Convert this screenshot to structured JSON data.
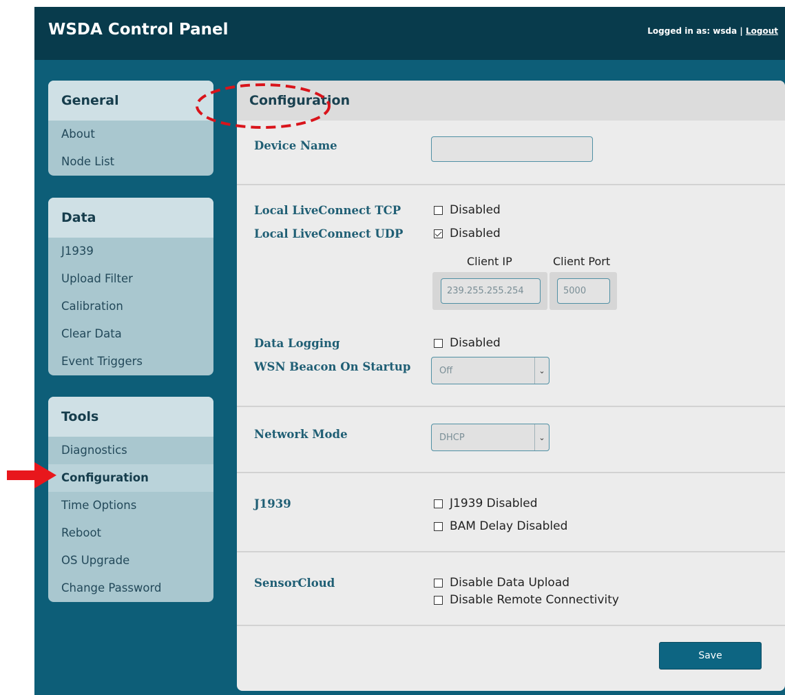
{
  "header": {
    "app_title": "WSDA Control Panel",
    "logged_in_text": "Logged in as: wsda |",
    "logout_label": "Logout"
  },
  "sidebar": {
    "general": {
      "title": "General",
      "items": [
        {
          "label": "About"
        },
        {
          "label": "Node List"
        }
      ]
    },
    "data": {
      "title": "Data",
      "items": [
        {
          "label": "J1939"
        },
        {
          "label": "Upload Filter"
        },
        {
          "label": "Calibration"
        },
        {
          "label": "Clear Data"
        },
        {
          "label": "Event Triggers"
        }
      ]
    },
    "tools": {
      "title": "Tools",
      "items": [
        {
          "label": "Diagnostics"
        },
        {
          "label": "Configuration",
          "active": true
        },
        {
          "label": "Time Options"
        },
        {
          "label": "Reboot"
        },
        {
          "label": "OS Upgrade"
        },
        {
          "label": "Change Password"
        }
      ]
    }
  },
  "config": {
    "title": "Configuration",
    "device_name": {
      "label": "Device Name",
      "value": ""
    },
    "local_tcp": {
      "label": "Local LiveConnect TCP",
      "option": "Disabled",
      "checked": false
    },
    "local_udp": {
      "label": "Local LiveConnect UDP",
      "option": "Disabled",
      "checked": true
    },
    "client_ip": {
      "label": "Client IP",
      "value": "239.255.255.254"
    },
    "client_port": {
      "label": "Client Port",
      "value": "5000"
    },
    "data_logging": {
      "label": "Data Logging",
      "option": "Disabled",
      "checked": false
    },
    "wsn_beacon": {
      "label": "WSN Beacon On Startup",
      "value": "Off"
    },
    "network_mode": {
      "label": "Network Mode",
      "value": "DHCP"
    },
    "j1939": {
      "label": "J1939",
      "options": [
        {
          "label": "J1939 Disabled",
          "checked": false
        },
        {
          "label": "BAM Delay Disabled",
          "checked": false
        }
      ]
    },
    "sensorcloud": {
      "label": "SensorCloud",
      "options": [
        {
          "label": "Disable Data Upload",
          "checked": false
        },
        {
          "label": "Disable Remote Connectivity",
          "checked": false
        }
      ]
    },
    "save_label": "Save"
  },
  "annotations": {
    "highlight_color": "#d9141b",
    "arrow_color": "#e8171c"
  },
  "icons": {
    "dropdown": "chevron-down-icon",
    "annotation_arrow": "arrow-right-icon"
  }
}
